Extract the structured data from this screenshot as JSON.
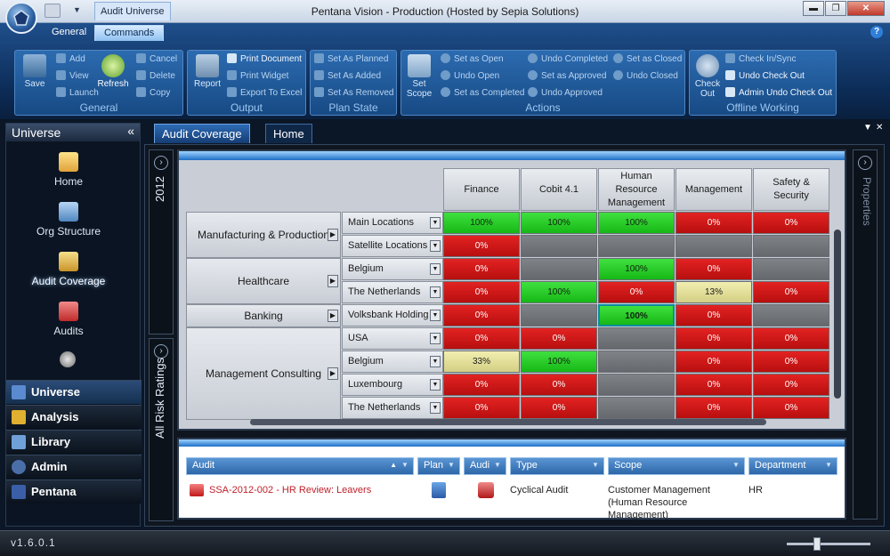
{
  "titlebar": {
    "context_tab": "Audit Universe",
    "title": "Pentana Vision - Production (Hosted by Sepia Solutions)",
    "minimize": "▬",
    "maximize": "❐",
    "close": "✕"
  },
  "ribbon": {
    "tabs": [
      "General",
      "Commands"
    ],
    "help": "?",
    "groups": {
      "general": {
        "label": "General",
        "save": "Save",
        "add": "Add",
        "view": "View",
        "launch": "Launch",
        "refresh": "Refresh",
        "cancel": "Cancel",
        "delete": "Delete",
        "copy": "Copy"
      },
      "output": {
        "label": "Output",
        "report": "Report",
        "print_document": "Print Document",
        "print_widget": "Print Widget",
        "export_excel": "Export To Excel"
      },
      "plan_state": {
        "label": "Plan State",
        "set_planned": "Set As Planned",
        "set_added": "Set As Added",
        "set_removed": "Set As Removed"
      },
      "actions": {
        "label": "Actions",
        "set_scope": "Set Scope",
        "set_open": "Set as Open",
        "undo_open": "Undo Open",
        "set_completed": "Set as Completed",
        "undo_completed": "Undo Completed",
        "set_approved": "Set as Approved",
        "undo_approved": "Undo Approved",
        "set_closed": "Set as Closed",
        "undo_closed": "Undo Closed"
      },
      "offline": {
        "label": "Offline Working",
        "check_out": "Check Out",
        "check_in_sync": "Check In/Sync",
        "undo_check_out": "Undo Check Out",
        "admin_undo": "Admin Undo Check Out"
      }
    }
  },
  "leftnav": {
    "title": "Universe",
    "collapse": "«",
    "items": [
      "Home",
      "Org Structure",
      "Audit Coverage",
      "Audits"
    ],
    "sections": [
      "Universe",
      "Analysis",
      "Library",
      "Admin",
      "Pentana"
    ]
  },
  "doctabs": [
    "Audit Coverage",
    "Home"
  ],
  "doc_controls": {
    "menu": "▼",
    "close": "✕"
  },
  "side_strips": {
    "year": "2012",
    "ratings": "All Risk Ratings",
    "properties": "Properties",
    "expand": "›"
  },
  "grid": {
    "columns": [
      "Finance",
      "Cobit 4.1",
      "Human Resource Management",
      "Management",
      "Safety & Security"
    ],
    "groups": [
      {
        "name": "Manufacturing & Production",
        "rows": [
          {
            "label": "Main Locations",
            "cells": [
              "100%",
              "100%",
              "100%",
              "0%",
              "0%"
            ],
            "status": [
              "green",
              "green",
              "green",
              "red",
              "red"
            ]
          },
          {
            "label": "Satellite Locations",
            "cells": [
              "0%",
              "",
              "",
              "",
              ""
            ],
            "status": [
              "red",
              "gray",
              "gray",
              "gray",
              "gray"
            ]
          }
        ]
      },
      {
        "name": "Healthcare",
        "rows": [
          {
            "label": "Belgium",
            "cells": [
              "0%",
              "",
              "100%",
              "0%",
              ""
            ],
            "status": [
              "red",
              "gray",
              "green",
              "red",
              "gray"
            ]
          },
          {
            "label": "The Netherlands",
            "cells": [
              "0%",
              "100%",
              "0%",
              "13%",
              "0%"
            ],
            "status": [
              "red",
              "green",
              "red",
              "yellow",
              "red"
            ]
          }
        ]
      },
      {
        "name": "Banking",
        "rows": [
          {
            "label": "Volksbank Holding",
            "cells": [
              "0%",
              "",
              "100%",
              "0%",
              ""
            ],
            "status": [
              "red",
              "gray",
              "green-selected",
              "red",
              "gray"
            ]
          }
        ]
      },
      {
        "name": "Management Consulting",
        "rows": [
          {
            "label": "USA",
            "cells": [
              "0%",
              "0%",
              "",
              "0%",
              "0%"
            ],
            "status": [
              "red",
              "red",
              "gray",
              "red",
              "red"
            ]
          },
          {
            "label": "Belgium",
            "cells": [
              "33%",
              "100%",
              "",
              "0%",
              "0%"
            ],
            "status": [
              "yellow",
              "green",
              "gray",
              "red",
              "red"
            ]
          },
          {
            "label": "Luxembourg",
            "cells": [
              "0%",
              "0%",
              "",
              "0%",
              "0%"
            ],
            "status": [
              "red",
              "red",
              "gray",
              "red",
              "red"
            ]
          },
          {
            "label": "The Netherlands",
            "cells": [
              "0%",
              "0%",
              "",
              "0%",
              "0%"
            ],
            "status": [
              "red",
              "red",
              "gray",
              "red",
              "red"
            ]
          }
        ]
      }
    ]
  },
  "audit_list": {
    "headers": [
      "Audit",
      "Plan",
      "Audi",
      "Type",
      "Scope",
      "Department"
    ],
    "rows": [
      {
        "audit": "SSA-2012-002 - HR Review: Leavers",
        "type": "Cyclical Audit",
        "scope": "Customer Management (Human Resource Management)",
        "department": "HR"
      }
    ]
  },
  "statusbar": {
    "version": "v1.6.0.1"
  },
  "colors": {
    "red": "#d41b1b",
    "green": "#2fd32f",
    "gray": "#73777c",
    "yellow": "#e6e29c",
    "accent": "#2e6bb6"
  }
}
